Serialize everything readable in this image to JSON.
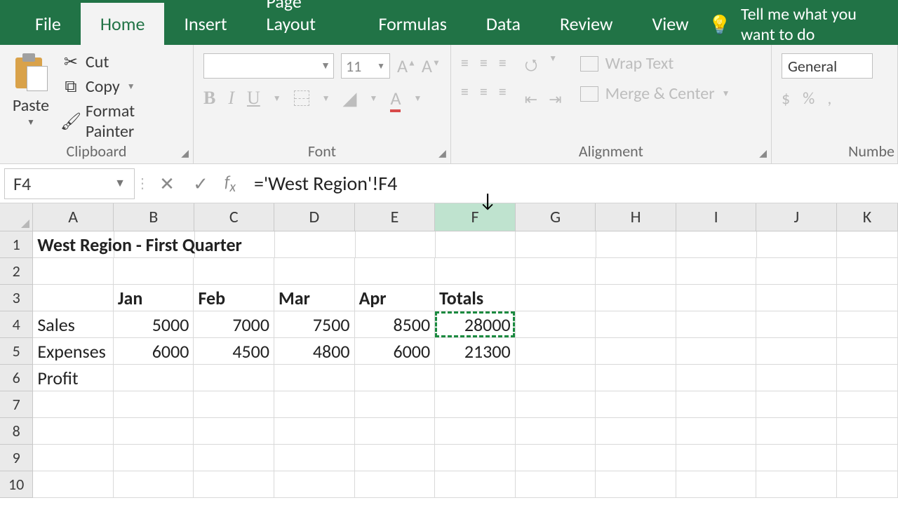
{
  "tabs": {
    "file": "File",
    "home": "Home",
    "insert": "Insert",
    "page_layout": "Page Layout",
    "formulas": "Formulas",
    "data": "Data",
    "review": "Review",
    "view": "View",
    "tellme": "Tell me what you want to do"
  },
  "ribbon": {
    "clipboard": {
      "paste": "Paste",
      "cut": "Cut",
      "copy": "Copy",
      "format_painter": "Format Painter",
      "group_label": "Clipboard"
    },
    "font": {
      "size": "11",
      "group_label": "Font"
    },
    "alignment": {
      "wrap_text": "Wrap Text",
      "merge_center": "Merge & Center",
      "group_label": "Alignment"
    },
    "number": {
      "format": "General",
      "group_label": "Numbe"
    }
  },
  "fx": {
    "namebox": "F4",
    "formula": "='West Region'!F4"
  },
  "columns": [
    "A",
    "B",
    "C",
    "D",
    "E",
    "F",
    "G",
    "H",
    "I",
    "J",
    "K"
  ],
  "active_col_index": 5,
  "rows": [
    "1",
    "2",
    "3",
    "4",
    "5",
    "6",
    "7",
    "8",
    "9",
    "10"
  ],
  "sheet": {
    "title": "West Region - First Quarter",
    "headers": {
      "b": "Jan",
      "c": "Feb",
      "d": "Mar",
      "e": "Apr",
      "f": "Totals"
    },
    "r4": {
      "label": "Sales",
      "b": "5000",
      "c": "7000",
      "d": "7500",
      "e": "8500",
      "f": "28000"
    },
    "r5": {
      "label": "Expenses",
      "b": "6000",
      "c": "4500",
      "d": "4800",
      "e": "6000",
      "f": "21300"
    },
    "r6": {
      "label": "Profit"
    }
  }
}
